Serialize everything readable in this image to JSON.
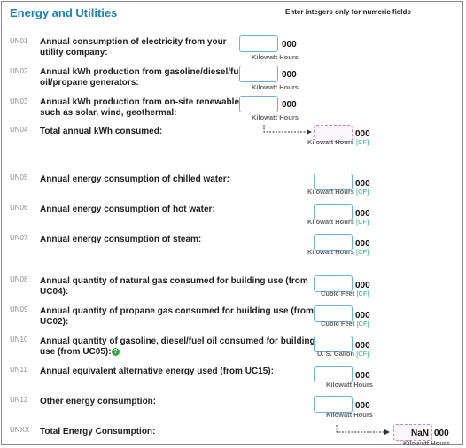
{
  "header": {
    "title": "Energy and Utilities",
    "note": "Enter integers only for numeric fields"
  },
  "thousands": "000",
  "cf_mark": "[CF]",
  "help_glyph": "?",
  "rows": [
    {
      "code": "UN01",
      "label1": "Annual consumption of electricity from your",
      "label2": "utility company:",
      "unit": "Kilowatt Hours"
    },
    {
      "code": "UN02",
      "label1": "Annual kWh production from gasoline/diesel/fuel",
      "label2": "oil/propane generators:",
      "unit": "Kilowatt Hours"
    },
    {
      "code": "UN03",
      "label1": "Annual kWh production from on-site renewables",
      "label2": "such as solar, wind, geothermal:",
      "unit": "Kilowatt Hours"
    },
    {
      "code": "UN04",
      "label1": "Total annual kWh consumed:",
      "unit": "Kilowatt Hours"
    },
    {
      "code": "UN05",
      "label1": "Annual energy consumption of chilled water:",
      "unit": "Kilowatt Hours"
    },
    {
      "code": "UN06",
      "label1": "Annual energy consumption of hot water:",
      "unit": "Kilowatt Hours"
    },
    {
      "code": "UN07",
      "label1": "Annual energy consumption of steam:",
      "unit": "Kilowatt Hours"
    },
    {
      "code": "UN08",
      "label1": "Annual quantity of natural gas consumed for building use (from",
      "label2": "UC04):",
      "unit": "Cubic Feet"
    },
    {
      "code": "UN09",
      "label1": "Annual quantity of propane gas consumed for building use (from",
      "label2": "UC02):",
      "unit": "Cubic Feet"
    },
    {
      "code": "UN10",
      "label1": "Annual quantity of gasoline, diesel/fuel oil consumed for building",
      "label2": "use (from UC05):",
      "unit": "U. S. Gallon"
    },
    {
      "code": "UN11",
      "label1": "Annual equivalent alternative energy used (from UC15):",
      "unit": "Kilowatt Hours"
    },
    {
      "code": "UN12",
      "label1": "Other energy consumption:",
      "unit": "Kilowatt Hours"
    },
    {
      "code": "UNXX",
      "label1": "Total Energy Consumption:",
      "unit": "Kilowatt Hours",
      "value": "NaN"
    }
  ]
}
